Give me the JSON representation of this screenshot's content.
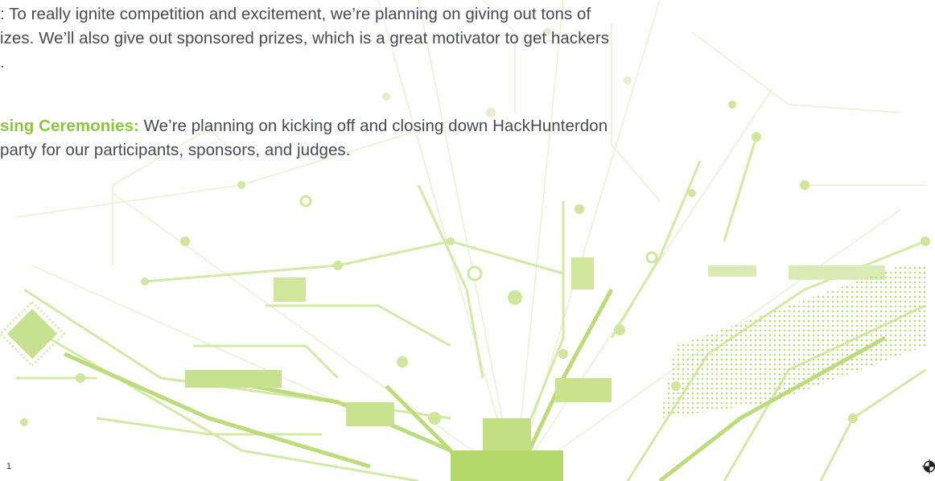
{
  "paragraphs": [
    {
      "lead": "",
      "lines": [
        ": To really ignite competition and excitement, we’re planning on giving out tons of",
        "izes. We’ll also give out sponsored prizes, which is a great motivator to get hackers",
        "."
      ]
    },
    {
      "lead": "sing Ceremonies:",
      "lines": [
        " We’re planning on kicking off and closing down HackHunterdon",
        "party for our participants, sponsors, and judges."
      ]
    }
  ],
  "page_number": "1",
  "colors": {
    "accent": "#8cc63f",
    "text": "#454b52",
    "circuit_light": "#dcedb8",
    "circuit_mid": "#c4e08a",
    "circuit_strong": "#a9d25a"
  },
  "decorations": {
    "background": "circuit-board-graphic",
    "corner_mark": "registration-mark-icon"
  }
}
